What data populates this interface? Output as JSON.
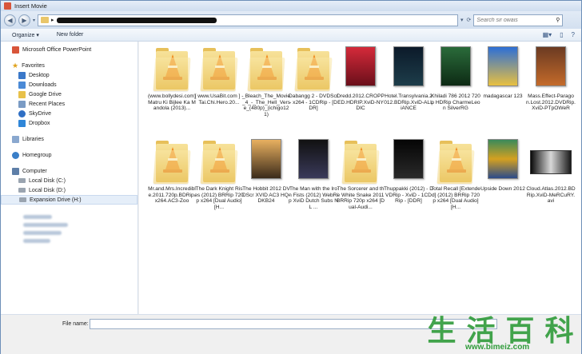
{
  "window": {
    "title": "Insert Movie"
  },
  "address": {
    "path_prefix": "▸"
  },
  "search": {
    "placeholder": "Search sir owais"
  },
  "toolbar": {
    "organize_label": "Organize ▾",
    "new_folder_label": "New folder"
  },
  "sidebar": {
    "app_item": "Microsoft Office PowerPoint",
    "favorites_label": "Favorites",
    "favorites": [
      "Desktop",
      "Downloads",
      "Google Drive",
      "Recent Places",
      "SkyDrive",
      "Dropbox"
    ],
    "libraries_label": "Libraries",
    "homegroup_label": "Homegroup",
    "computer_label": "Computer",
    "drives": [
      "Local Disk (C:)",
      "Local Disk (D:)",
      "Expansion Drive (H:)"
    ],
    "selected_drive": "Expansion Drive (H:)"
  },
  "files": [
    {
      "label": "(www.bollydesi.com) Matru Ki Bijlee Ka Mandola (2013)...",
      "kind": "vlc-folder"
    },
    {
      "label": "[ www.UsaBit.com ] - Tai.Chi.Hero.20...",
      "kind": "vlc-folder"
    },
    {
      "label": "_Bleach_The_Movie_4_-_The_Hell_Verse_(480p)_(ichigo121)",
      "kind": "vlc-folder"
    },
    {
      "label": "Dabangg 2 - DVDScr - x264 - 1CDRip - [DDR]",
      "kind": "vlc-folder"
    },
    {
      "label": "Dredd.2012.CROPPED.HDRIP.XviD-NYDIC",
      "kind": "poster-red"
    },
    {
      "label": "Hotel.Transylvania.2012.BDRip.XviD-ALLiANCE",
      "kind": "poster-dark"
    },
    {
      "label": "Khiladi 786 2012 720p HDRip CharmeLeon SilverRG",
      "kind": "poster-green"
    },
    {
      "label": "madagascar 123",
      "kind": "poster-blue"
    },
    {
      "label": "Mass.Effect-Paragon.Lost.2012.DVDRip.XviD-PTpOWeR",
      "kind": "poster-brown"
    },
    {
      "label": "Mr.and.Mrs.Incredible.2011.720p.BDRip.x264.AC3-Zoo",
      "kind": "vlc-folder"
    },
    {
      "label": "The Dark Knight Rises (2012) BRRip 720p x264 [Dual Audio] [H...",
      "kind": "vlc-folder"
    },
    {
      "label": "The Hobbit 2012 DVDScr XVID AC3 HQ-DKB24",
      "kind": "poster-amber"
    },
    {
      "label": "The Man with the Iron Fists (2012) WebRip XviD Dutch Subs NL ...",
      "kind": "poster-night"
    },
    {
      "label": "The Sorcerer and the White Snake 2011 BRRip 720p x264 [Dual-Audi...",
      "kind": "vlc-folder"
    },
    {
      "label": "Thuppakki (2012) - DVDRip - XviD - 1CDRip - [DDR]",
      "kind": "poster-black"
    },
    {
      "label": "Total Recall [Extended] (2012) BRRip 720p x264 [Dual Audio] [H...",
      "kind": "vlc-folder"
    },
    {
      "label": "Upside Down 2012",
      "kind": "poster-colorful"
    },
    {
      "label": "Cloud.Atlas.2012.BDRip.XviD-MeRCuRY.avi",
      "kind": "video-file"
    }
  ],
  "bottom": {
    "filename_label": "File name:",
    "filename_value": ""
  },
  "watermark": {
    "chars": [
      "生",
      "活",
      "百",
      "科"
    ],
    "url": "www.bimeiz.com"
  },
  "colors": {
    "accent": "#3b6aa8",
    "selection": "#e5eef9",
    "watermark": "#2f9b3a"
  }
}
